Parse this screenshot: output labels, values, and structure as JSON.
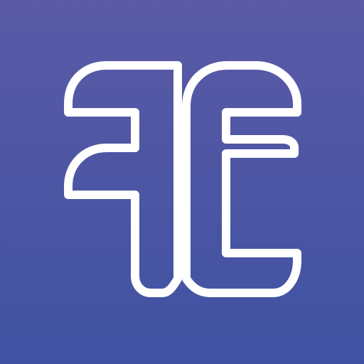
{
  "app_icon": {
    "name": "app-logo-monogram",
    "colors": {
      "background_top": "#5a5aa6",
      "background_bottom": "#3f52a2",
      "outline": "#ffffff"
    }
  }
}
